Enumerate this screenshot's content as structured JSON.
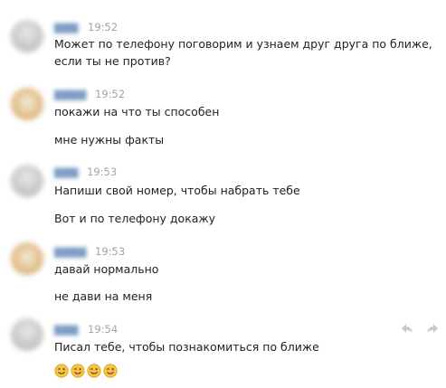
{
  "messages": [
    {
      "time": "19:52",
      "lines": [
        "Может по телефону поговорим и узнаем друг друга по ближе,",
        "если ты не против?"
      ]
    },
    {
      "time": "19:52",
      "lines": [
        "покажи на что ты способен",
        "мне нужны факты"
      ]
    },
    {
      "time": "19:53",
      "lines": [
        "Напиши свой номер, чтобы набрать тебе",
        "Вот и по телефону докажу"
      ]
    },
    {
      "time": "19:53",
      "lines": [
        "давай нормально",
        "не дави на меня"
      ]
    },
    {
      "time": "19:54",
      "lines": [
        "Писал тебе, чтобы познакомиться по ближе"
      ],
      "emoji": "winking-face",
      "emoji_count": 4
    }
  ],
  "icons": {
    "reply": "reply-arrow-icon",
    "forward": "forward-arrow-icon"
  },
  "colors": {
    "time": "#9da5ad",
    "name": "#7a9bc4",
    "text": "#222222",
    "emoji": "#f5c443"
  }
}
